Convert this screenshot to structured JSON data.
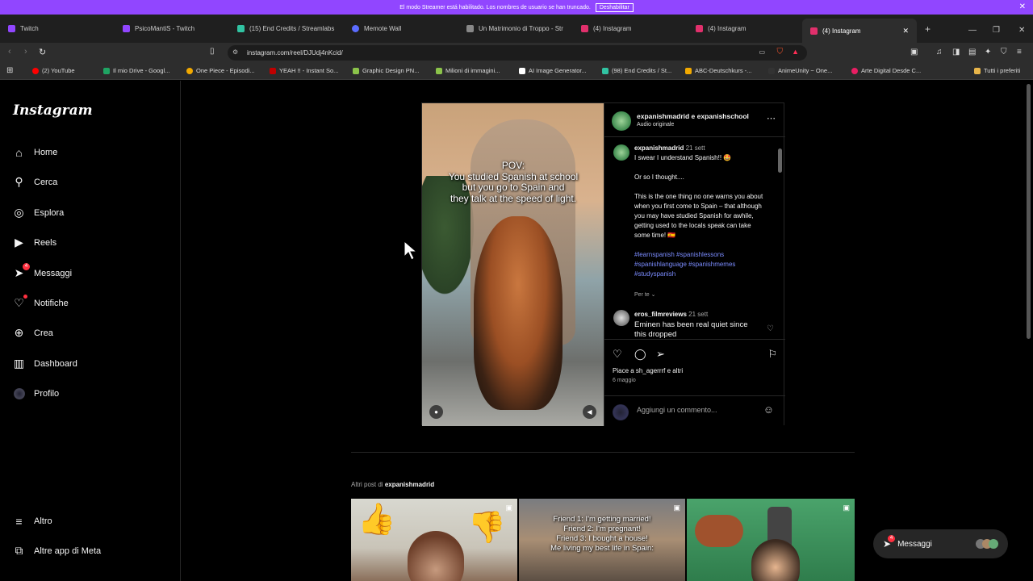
{
  "banner": {
    "text": "El modo Streamer está habilitado. Los nombres de usuario se han truncado.",
    "button": "Deshabilitar",
    "color": "#9146ff"
  },
  "tabs": [
    {
      "label": "Twitch",
      "color": "#9146ff"
    },
    {
      "label": "PsicoMantiS - Twitch",
      "color": "#9146ff"
    },
    {
      "label": "(15) End Credits / Streamlabs",
      "color": "#31c3a2"
    },
    {
      "label": "Memote Wall",
      "color": "#5b6cff"
    },
    {
      "label": "Un Matrimonio di Troppo - Str",
      "color": "#888888"
    },
    {
      "label": "(4) Instagram",
      "color": "#e1306c"
    },
    {
      "label": "(4) Instagram",
      "color": "#e1306c"
    },
    {
      "label": "(4) Instagram",
      "color": "#e1306c",
      "active": true
    }
  ],
  "address": {
    "url": "instagram.com/reel/DJUdj4nKcid/"
  },
  "bookmarks": [
    {
      "label": "(2) YouTube",
      "color": "#ff0000"
    },
    {
      "label": "Il mio Drive - Googl...",
      "color": "#1fa463"
    },
    {
      "label": "One Piece - Episodi...",
      "color": "#f2a900"
    },
    {
      "label": "YEAH !! - Instant So...",
      "color": "#c00000"
    },
    {
      "label": "Graphic Design PN...",
      "color": "#8bc34a"
    },
    {
      "label": "Milioni di immagini...",
      "color": "#8bc34a"
    },
    {
      "label": "AI Image Generator...",
      "color": "#ffffff"
    },
    {
      "label": "(98) End Credits / St...",
      "color": "#31c3a2"
    },
    {
      "label": "ABC-Deutschkurs -...",
      "color": "#f2a900"
    },
    {
      "label": "AnimeUnity ~ One...",
      "color": "#333333"
    },
    {
      "label": "Arte Digital Desde C...",
      "color": "#e91e63"
    }
  ],
  "bookmarks_all": "Tutti i preferiti",
  "sidebar": {
    "logo": "Instagram",
    "items": [
      {
        "label": "Home",
        "icon": "home-icon"
      },
      {
        "label": "Cerca",
        "icon": "search-icon"
      },
      {
        "label": "Esplora",
        "icon": "compass-icon"
      },
      {
        "label": "Reels",
        "icon": "reels-icon"
      },
      {
        "label": "Messaggi",
        "icon": "messenger-icon",
        "badge": "4"
      },
      {
        "label": "Notifiche",
        "icon": "heart-icon"
      },
      {
        "label": "Crea",
        "icon": "plus-square-icon"
      },
      {
        "label": "Dashboard",
        "icon": "dashboard-icon"
      },
      {
        "label": "Profilo",
        "icon": "avatar-icon"
      }
    ],
    "bottom": [
      {
        "label": "Altro",
        "icon": "menu-icon"
      },
      {
        "label": "Altre app di Meta",
        "icon": "meta-apps-icon"
      }
    ]
  },
  "post": {
    "video_text": "POV:\nYou studied Spanish at school\nbut you go to Spain and\nthey talk at the speed of light.",
    "header_user": "expanishmadrid e expanishschool",
    "header_sub": "Audio originale",
    "caption_user": "expanishmadrid",
    "caption_date": "21 sett",
    "caption_line1": "I swear I understand Spanish!! 🤩",
    "caption_line2": "Or so I thought....",
    "caption_body": "This is the one thing no one warns you about when you first come to Spain – that although you may have studied Spanish for awhile, getting used to the locals speak can take some time! 🇪🇸",
    "hashtags": "#learnspanish #spanishlessons #spanishlanguage #spanishmemes #studyspanish",
    "per_te": "Per te",
    "comment_user": "eros_filmreviews",
    "comment_date": "21 sett",
    "comment_text": "Eminen has been real quiet since this dropped",
    "likes": "Piace a sh_agerrrf e altri",
    "post_date": "6 maggio",
    "add_comment_placeholder": "Aggiungi un commento..."
  },
  "more_posts": {
    "prefix": "Altri post di",
    "user": "expanishmadrid"
  },
  "thumbs": [
    {
      "text": ""
    },
    {
      "text": "Friend 1: I'm getting married!\nFriend 2: I'm pregnant!\nFriend 3: I bought a house!\nMe living my best life in Spain:"
    },
    {
      "text": ""
    }
  ],
  "messages": {
    "label": "Messaggi",
    "badge": "4"
  }
}
